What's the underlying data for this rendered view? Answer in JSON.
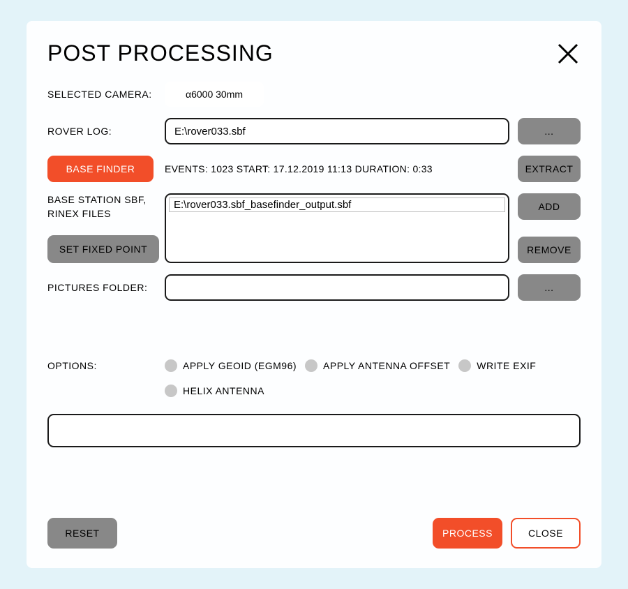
{
  "title": "POST PROCESSING",
  "camera": {
    "label": "SELECTED CAMERA:",
    "value": "α6000 30mm"
  },
  "rover_log": {
    "label": "ROVER LOG:",
    "value": "E:\\rover033.sbf",
    "browse": "..."
  },
  "base_finder": {
    "button": "BASE FINDER",
    "info": "EVENTS: 1023  START: 17.12.2019 11:13  DURATION: 0:33",
    "extract": "EXTRACT"
  },
  "base_station": {
    "label": "BASE STATION SBF, RINEX FILES",
    "fixed_point": "SET FIXED POINT",
    "add": "ADD",
    "remove": "REMOVE",
    "files": [
      "E:\\rover033.sbf_basefinder_output.sbf"
    ]
  },
  "pictures": {
    "label": "PICTURES FOLDER:",
    "value": "",
    "browse": "..."
  },
  "options": {
    "label": "OPTIONS:",
    "items": [
      {
        "label": "APPLY GEOID (EGM96)"
      },
      {
        "label": "APPLY ANTENNA OFFSET"
      },
      {
        "label": "WRITE EXIF"
      },
      {
        "label": "HELIX ANTENNA"
      }
    ]
  },
  "log_box": {
    "value": ""
  },
  "footer": {
    "reset": "RESET",
    "process": "PROCESS",
    "close": "CLOSE"
  }
}
